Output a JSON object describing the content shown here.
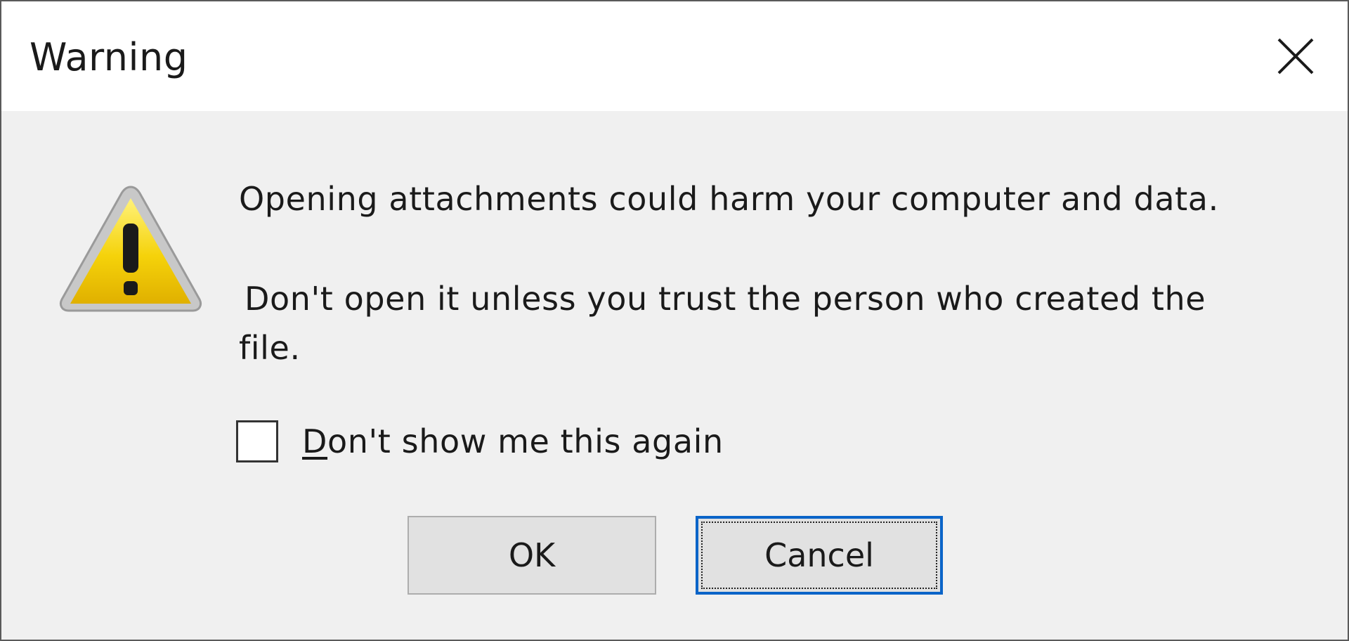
{
  "window": {
    "title": "Warning",
    "close_icon": "close-icon"
  },
  "content": {
    "icon": "warning-icon",
    "line1": "Opening attachments could harm your computer and data.",
    "line2": "Don't open it unless you trust the person who created the",
    "line3": "file."
  },
  "checkbox": {
    "label_accel": "D",
    "label_rest": "on't show me this again",
    "checked": false
  },
  "buttons": {
    "ok_label": "OK",
    "cancel_label": "Cancel"
  },
  "colors": {
    "focus_border": "#0a64c8",
    "warning_yellow": "#f5d20a"
  }
}
